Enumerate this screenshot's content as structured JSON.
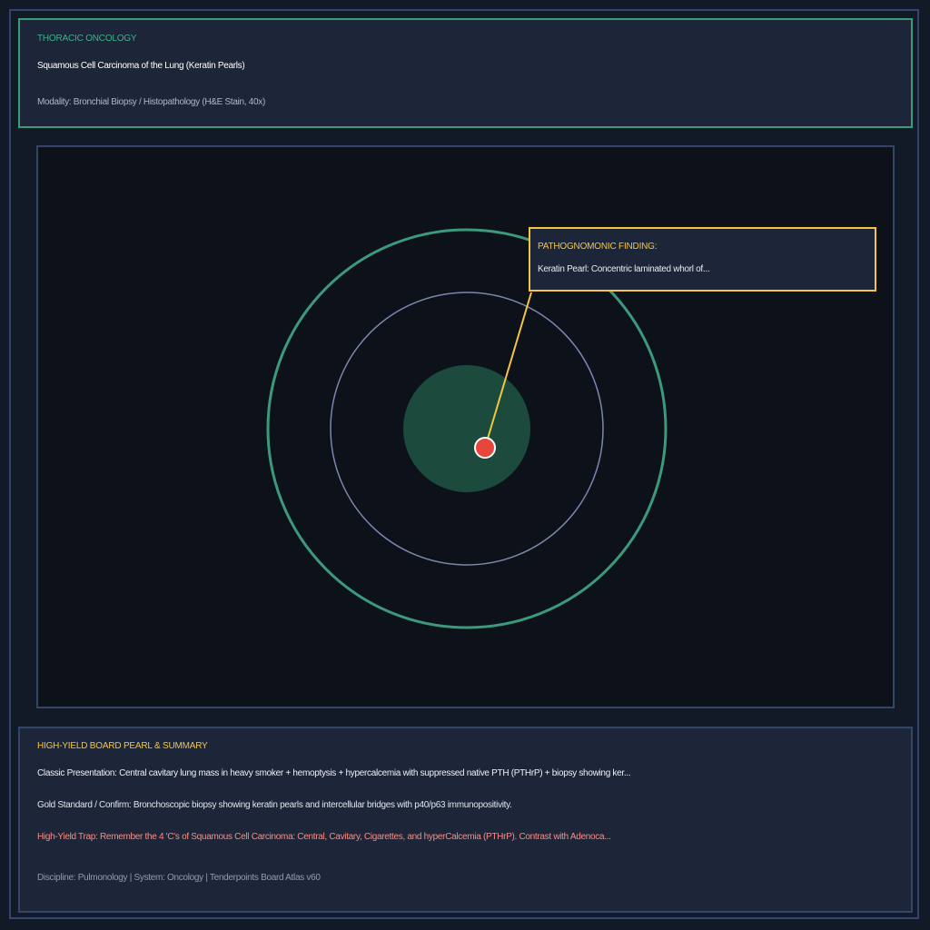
{
  "header": {
    "category": "THORACIC ONCOLOGY",
    "title": "Squamous Cell Carcinoma of the Lung (Keratin Pearls)",
    "modality": "Modality: Bronchial Biopsy / Histopathology (H&E Stain, 40x)"
  },
  "callout": {
    "label": "PATHOGNOMONIC FINDING:",
    "text": "Keratin Pearl: Concentric laminated whorl of..."
  },
  "summary": {
    "title": "HIGH-YIELD BOARD PEARL & SUMMARY",
    "presentation": "Classic Presentation: Central cavitary lung mass in heavy smoker + hemoptysis + hypercalcemia with suppressed native PTH (PTHrP) + biopsy showing ker...",
    "gold_standard": "Gold Standard / Confirm: Bronchoscopic biopsy showing keratin pearls and intercellular bridges with p40/p63 immunopositivity.",
    "trap": "High-Yield Trap: Remember the 4 'C's of Squamous Cell Carcinoma: Central, Cavitary, Cigarettes, and hyperCalcemia (PTHrP). Contrast with Adenoca...",
    "footer": "Discipline: Pulmonology | System: Oncology | Tenderpoints Board Atlas v60"
  },
  "colors": {
    "accent_green": "#3c9a7c",
    "accent_yellow": "#f4c542",
    "marker_red": "#e8453c",
    "trap_text": "#ff8a80",
    "ring_blue": "#7a88b0",
    "core_fill": "#1c4a3d"
  }
}
